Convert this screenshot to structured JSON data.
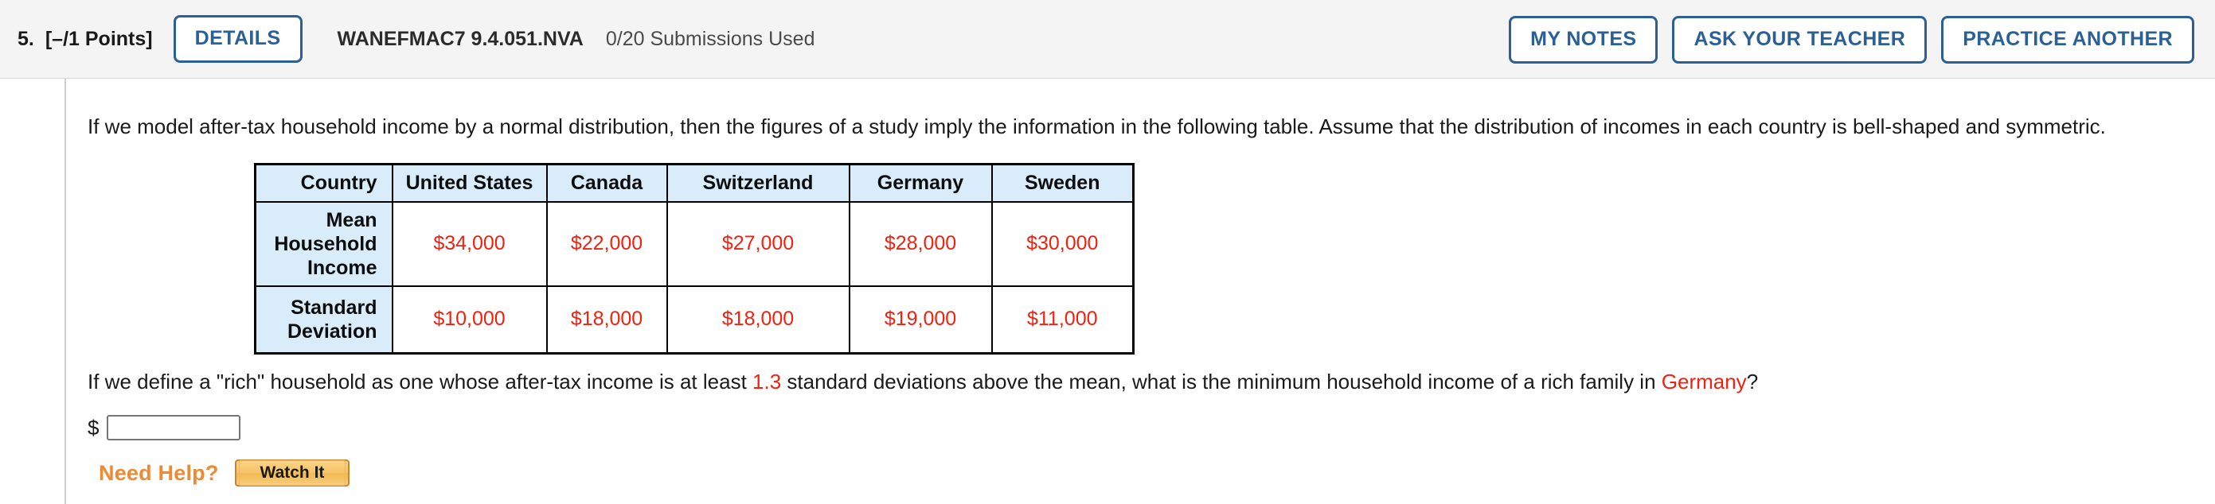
{
  "header": {
    "question_number": "5.",
    "points": "[–/1 Points]",
    "details_button": "DETAILS",
    "problem_code": "WANEFMAC7 9.4.051.NVA",
    "submissions": "0/20 Submissions Used",
    "my_notes_button": "MY NOTES",
    "ask_teacher_button": "ASK YOUR TEACHER",
    "practice_another_button": "PRACTICE ANOTHER",
    "accent_color": "#2b6096"
  },
  "problem": {
    "intro": "If we model after-tax household income by a normal distribution, then the figures of a study imply the information in the following table. Assume that the distribution of incomes in each country is bell-shaped and symmetric.",
    "question_part1": "If we define a \"rich\" household as one whose after-tax income is at least ",
    "question_value": "1.3",
    "question_part2": " standard deviations above the mean, what is the minimum household income of a rich family in ",
    "question_country": "Germany",
    "question_part3": "?",
    "answer_prefix": "$",
    "answer_value": "",
    "answer_placeholder": ""
  },
  "table": {
    "row_label_header": "Country",
    "columns": [
      "United States",
      "Canada",
      "Switzerland",
      "Germany",
      "Sweden"
    ],
    "rows": [
      {
        "label": "Mean Household Income",
        "values": [
          "$34,000",
          "$22,000",
          "$27,000",
          "$28,000",
          "$30,000"
        ]
      },
      {
        "label": "Standard Deviation",
        "values": [
          "$10,000",
          "$18,000",
          "$18,000",
          "$19,000",
          "$11,000"
        ]
      }
    ],
    "header_bg": "#d8ecfa",
    "value_color": "#ee2211"
  },
  "help": {
    "label": "Need Help?",
    "watch_it_button": "Watch It",
    "accent_color": "#ee8a33"
  }
}
